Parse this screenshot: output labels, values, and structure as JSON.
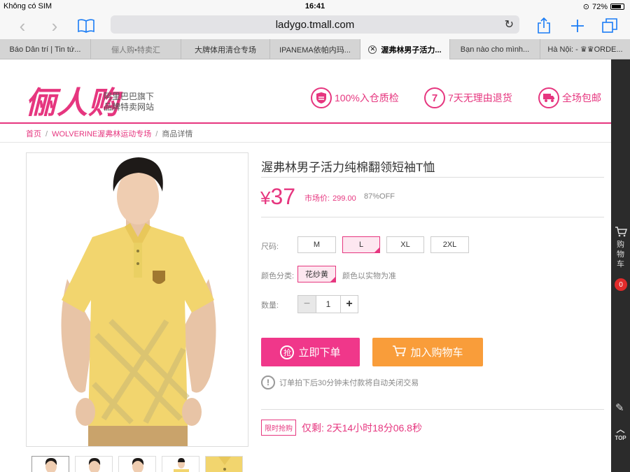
{
  "status": {
    "carrier": "Không có SIM",
    "time": "16:41",
    "battery": "72%"
  },
  "browser": {
    "url": "ladygo.tmall.com",
    "tabs": [
      {
        "label": "Báo Dân trí | Tin tứ..."
      },
      {
        "label": "俪人购•特卖汇"
      },
      {
        "label": "大牌体用清仓专场"
      },
      {
        "label": "IPANEMA依帕内玛..."
      },
      {
        "label": "渥弗林男子活力..."
      },
      {
        "label": "Bạn nào cho mình..."
      },
      {
        "label": "Hà Nội: - ♛♛ORDE..."
      }
    ]
  },
  "site": {
    "logo": "俪人购",
    "slogan_line1": "阿里巴巴旗下",
    "slogan_line2": "品牌特卖网站",
    "promos": [
      {
        "icon": "shield-icon",
        "label": "100%入仓质检"
      },
      {
        "icon": "seven-days-icon",
        "label": "7天无理由退货",
        "glyph": "7"
      },
      {
        "icon": "truck-icon",
        "label": "全场包邮"
      }
    ],
    "breadcrumb": {
      "home": "首页",
      "category": "WOLVERINE渥弗林运动专场",
      "current": "商品详情"
    }
  },
  "product": {
    "title": "渥弗林男子活力纯棉翻领短袖T恤",
    "currency": "¥",
    "price": "37",
    "market_label": "市场价:",
    "market_value": "299.00",
    "discount": "87%OFF",
    "size_label": "尺码:",
    "sizes": [
      "M",
      "L",
      "XL",
      "2XL"
    ],
    "selected_size": "L",
    "color_label": "颜色分类:",
    "color": "花纱黄",
    "color_note": "颜色以实物为准",
    "qty_label": "数量:",
    "qty": "1",
    "buy_label": "立即下单",
    "buy_icon_glyph": "抢",
    "cart_label": "加入购物车",
    "notice": "订单拍下后30分钟未付款将自动关闭交易",
    "flash_tag": "限时抢购",
    "remaining": "仅剩: 2天14小时18分06.8秒",
    "shirt_color": "#f2d56e"
  },
  "sidebar": {
    "cart_label": "购物车",
    "cart_count": "0",
    "top_label": "TOP"
  }
}
